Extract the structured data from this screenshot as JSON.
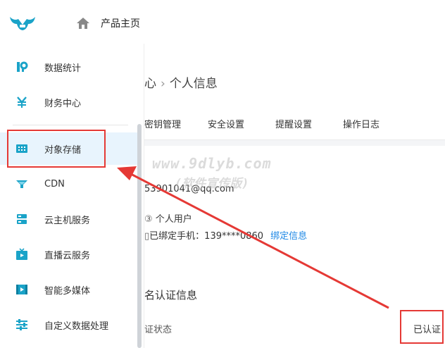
{
  "header": {
    "home_label": "产品主页"
  },
  "sidebar": {
    "items": [
      {
        "label": "数据统计",
        "icon": "stats-icon"
      },
      {
        "label": "财务中心",
        "icon": "yen-icon"
      },
      {
        "label": "对象存储",
        "icon": "storage-grid-icon",
        "active": true
      },
      {
        "label": "CDN",
        "icon": "cdn-icon"
      },
      {
        "label": "云主机服务",
        "icon": "server-icon"
      },
      {
        "label": "直播云服务",
        "icon": "live-tv-icon"
      },
      {
        "label": "智能多媒体",
        "icon": "media-play-icon"
      },
      {
        "label": "自定义数据处理",
        "icon": "sliders-icon"
      }
    ]
  },
  "main": {
    "breadcrumb": {
      "prev": "心",
      "current": "个人信息"
    },
    "tabs": [
      "密钥管理",
      "安全设置",
      "提醒设置",
      "操作日志"
    ],
    "email": "53901041@qq.com",
    "account_type": "个人用户",
    "phone_label": "已绑定手机：",
    "phone_value": "139****0860",
    "bind_link": "绑定信息",
    "section_title": "名认证信息",
    "status_label": "证状态",
    "status_value": "已认证"
  },
  "watermark": {
    "line1": "www.9dlyb.com",
    "line2": "(软件宣传版)"
  },
  "colors": {
    "accent": "#1e88e5",
    "highlight": "#e53935",
    "active_bg": "#e8f4fd"
  }
}
